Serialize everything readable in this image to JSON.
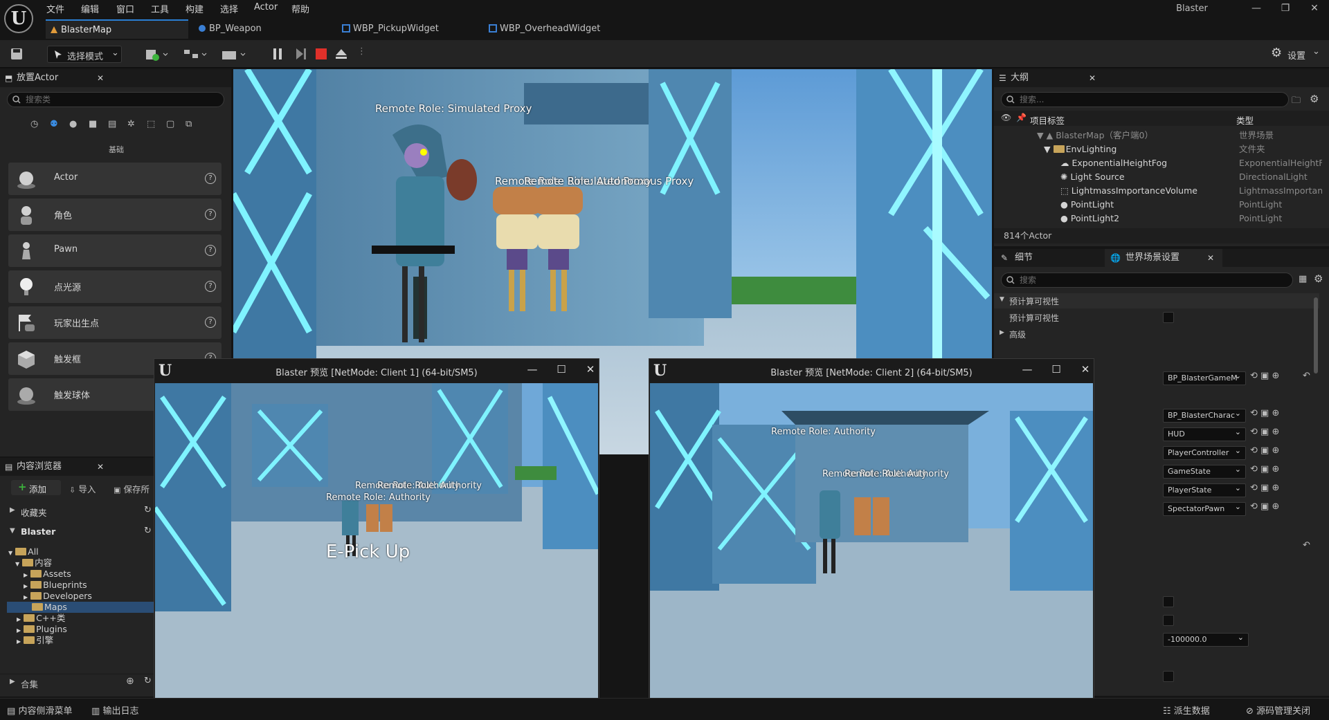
{
  "app": {
    "title": "Blaster"
  },
  "menu": [
    "文件",
    "编辑",
    "窗口",
    "工具",
    "构建",
    "选择",
    "Actor",
    "帮助"
  ],
  "tabs": [
    {
      "label": "BlasterMap",
      "active": true
    },
    {
      "label": "BP_Weapon"
    },
    {
      "label": "WBP_PickupWidget"
    },
    {
      "label": "WBP_OverheadWidget"
    }
  ],
  "toolbar": {
    "mode_label": "选择模式",
    "settings_label": "设置"
  },
  "place_actors": {
    "title": "放置Actor",
    "search_placeholder": "搜索类",
    "category": "基础",
    "items": [
      {
        "label": "Actor",
        "icon": "sphere-icon"
      },
      {
        "label": "角色",
        "icon": "character-icon"
      },
      {
        "label": "Pawn",
        "icon": "pawn-icon"
      },
      {
        "label": "点光源",
        "icon": "point-light-icon"
      },
      {
        "label": "玩家出生点",
        "icon": "player-start-icon"
      },
      {
        "label": "触发框",
        "icon": "trigger-box-icon"
      },
      {
        "label": "触发球体",
        "icon": "trigger-sphere-icon"
      }
    ]
  },
  "content_browser": {
    "title": "内容浏览器",
    "add_label": "添加",
    "import_label": "导入",
    "save_label": "保存所",
    "favorites": "收藏夹",
    "project": "Blaster",
    "tree": [
      "All",
      "内容",
      "Assets",
      "Blueprints",
      "Developers",
      "Maps",
      "C++类",
      "Plugins",
      "引擎"
    ],
    "collections": "合集"
  },
  "viewport": {
    "labels": [
      "Remote Role: Simulated Proxy",
      "Remote Role: Simulated Proxy",
      "Remote Role: Autonomous Proxy"
    ]
  },
  "pie1": {
    "title": "Blaster 预览 [NetMode: Client 1]  (64-bit/SM5)",
    "labels": [
      "Remote Role: Authority",
      "Remote Role: Authority",
      "Remote Role: Authority"
    ],
    "pickup": "E-Pick Up"
  },
  "pie2": {
    "title": "Blaster 预览 [NetMode: Client 2]  (64-bit/SM5)",
    "labels": [
      "Remote Role: Authority",
      "Remote Role: Authority",
      "Remote Role: Authority"
    ]
  },
  "outliner": {
    "title": "大纲",
    "search_placeholder": "搜索...",
    "col_label": "项目标签",
    "col_type": "类型",
    "rows": [
      {
        "name": "BlasterMap（客户端0）",
        "type": "世界场景"
      },
      {
        "name": "EnvLighting",
        "type": "文件夹"
      },
      {
        "name": "ExponentialHeightFog",
        "type": "ExponentialHeightF"
      },
      {
        "name": "Light Source",
        "type": "DirectionalLight"
      },
      {
        "name": "LightmassImportanceVolume",
        "type": "LightmassImportan"
      },
      {
        "name": "PointLight",
        "type": "PointLight"
      },
      {
        "name": "PointLight2",
        "type": "PointLight"
      }
    ],
    "count": "814个Actor"
  },
  "details": {
    "tab1": "细节",
    "tab2": "世界场景设置",
    "search_placeholder": "搜索",
    "section": "预计算可视性",
    "prop": "预计算可视性",
    "advanced": "高级",
    "combos": [
      "BP_BlasterGameM",
      "BP_BlasterCharac",
      "HUD",
      "PlayerController",
      "GameState",
      "PlayerState",
      "SpectatorPawn"
    ],
    "kill_z": "-100000.0"
  },
  "statusbar": {
    "drawer": "内容侧滑菜单",
    "log": "输出日志",
    "derived": "派生数据",
    "scc": "源码管理关闭"
  }
}
